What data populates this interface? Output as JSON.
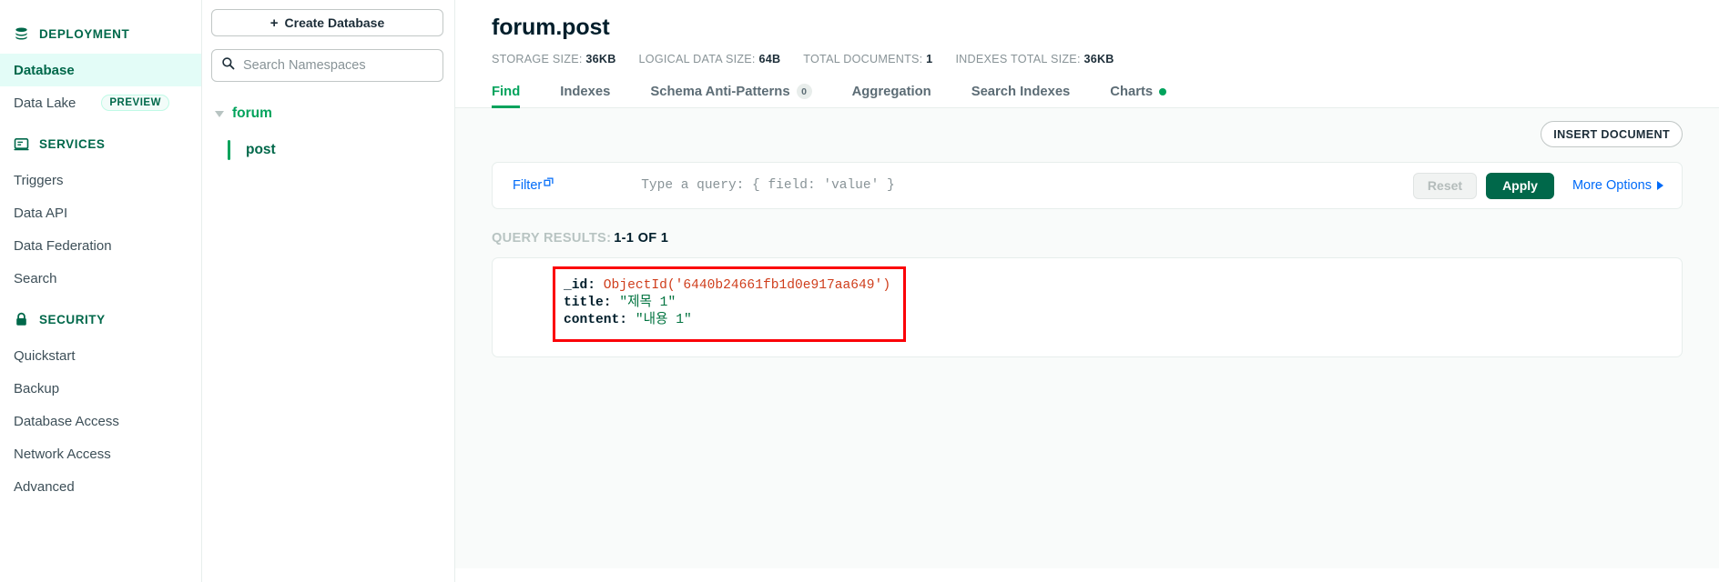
{
  "sidebar": {
    "sections": [
      {
        "icon": "database-icon",
        "label": "DEPLOYMENT",
        "items": [
          {
            "label": "Database",
            "active": true,
            "badge": null
          },
          {
            "label": "Data Lake",
            "active": false,
            "badge": "PREVIEW"
          }
        ]
      },
      {
        "icon": "services-icon",
        "label": "SERVICES",
        "items": [
          {
            "label": "Triggers",
            "active": false,
            "badge": null
          },
          {
            "label": "Data API",
            "active": false,
            "badge": null
          },
          {
            "label": "Data Federation",
            "active": false,
            "badge": null
          },
          {
            "label": "Search",
            "active": false,
            "badge": null
          }
        ]
      },
      {
        "icon": "lock-icon",
        "label": "SECURITY",
        "items": [
          {
            "label": "Quickstart",
            "active": false,
            "badge": null
          },
          {
            "label": "Backup",
            "active": false,
            "badge": null
          },
          {
            "label": "Database Access",
            "active": false,
            "badge": null
          },
          {
            "label": "Network Access",
            "active": false,
            "badge": null
          },
          {
            "label": "Advanced",
            "active": false,
            "badge": null
          }
        ]
      }
    ]
  },
  "namespaces": {
    "create_button_label": "Create Database",
    "create_button_plus": "+",
    "search_placeholder": "Search Namespaces",
    "search_value": "",
    "tree": {
      "database": "forum",
      "collections": [
        "post"
      ]
    }
  },
  "collection": {
    "title": "forum.post",
    "stats": [
      {
        "label": "STORAGE SIZE:",
        "value": "36KB"
      },
      {
        "label": "LOGICAL DATA SIZE:",
        "value": "64B"
      },
      {
        "label": "TOTAL DOCUMENTS:",
        "value": "1"
      },
      {
        "label": "INDEXES TOTAL SIZE:",
        "value": "36KB"
      }
    ],
    "tabs": [
      {
        "label": "Find",
        "active": true,
        "badge": null,
        "dot": false
      },
      {
        "label": "Indexes",
        "active": false,
        "badge": null,
        "dot": false
      },
      {
        "label": "Schema Anti-Patterns",
        "active": false,
        "badge": "0",
        "dot": false
      },
      {
        "label": "Aggregation",
        "active": false,
        "badge": null,
        "dot": false
      },
      {
        "label": "Search Indexes",
        "active": false,
        "badge": null,
        "dot": false
      },
      {
        "label": "Charts",
        "active": false,
        "badge": null,
        "dot": true
      }
    ]
  },
  "toolbar": {
    "insert_document_label": "INSERT DOCUMENT"
  },
  "filter": {
    "link_label": "Filter",
    "query_placeholder": "Type a query: { field: 'value' }",
    "query_value": "",
    "reset_label": "Reset",
    "apply_label": "Apply",
    "more_options_label": "More Options"
  },
  "results": {
    "label": "QUERY RESULTS:",
    "range": "1-1 OF 1",
    "document": {
      "id_key": "_id:",
      "id_value": "ObjectId('6440b24661fb1d0e917aa649')",
      "title_key": "title:",
      "title_value": "\"제목 1\"",
      "content_key": "content:",
      "content_value": "\"내용 1\""
    }
  },
  "colors": {
    "brand_green": "#00684a",
    "accent_green": "#00a35c",
    "link_blue": "#016bf8",
    "highlight_red": "#fb0007",
    "objectid_red": "#cf3e1c",
    "string_green": "#00733f"
  }
}
